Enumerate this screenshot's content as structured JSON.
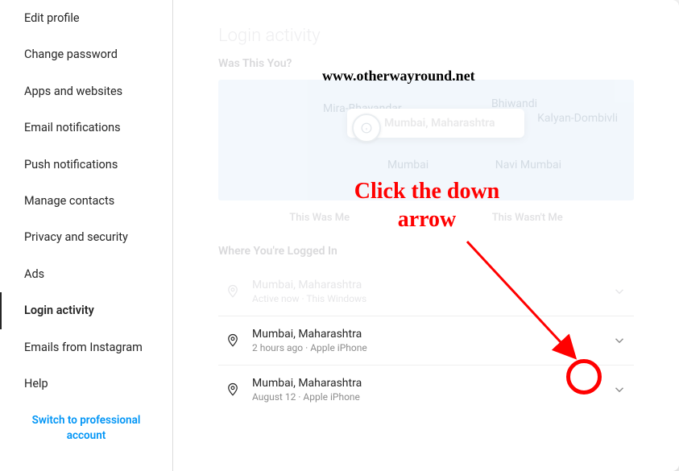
{
  "sidebar": {
    "items": [
      {
        "label": "Edit profile"
      },
      {
        "label": "Change password"
      },
      {
        "label": "Apps and websites"
      },
      {
        "label": "Email notifications"
      },
      {
        "label": "Push notifications"
      },
      {
        "label": "Manage contacts"
      },
      {
        "label": "Privacy and security"
      },
      {
        "label": "Ads"
      },
      {
        "label": "Login activity"
      },
      {
        "label": "Emails from Instagram"
      },
      {
        "label": "Help"
      }
    ],
    "switch_label": "Switch to professional account"
  },
  "main": {
    "title": "Login activity",
    "was_this_you": "Was This You?",
    "tooltip_location": "Mumbai, Maharashtra",
    "tooltip_sub": "",
    "map_labels": {
      "mira": "Mira-Bhayandar",
      "bhiwandi": "Bhiwandi",
      "kalyan": "Kalyan-Dombivli",
      "mumbai": "Mumbai",
      "navi": "Navi Mumbai"
    },
    "this_was_me": "This Was Me",
    "this_wasnt_me": "This Wasn't Me",
    "where_logged_in": "Where You're Logged In",
    "sessions": [
      {
        "location": "Mumbai, Maharashtra",
        "meta": "Active now · This Windows"
      },
      {
        "location": "Mumbai, Maharashtra",
        "meta": "2 hours ago · Apple iPhone"
      },
      {
        "location": "Mumbai, Maharashtra",
        "meta": "August 12 · Apple iPhone"
      }
    ]
  },
  "annotations": {
    "watermark": "www.otherwayround.net",
    "instruction": "Click the down arrow"
  }
}
